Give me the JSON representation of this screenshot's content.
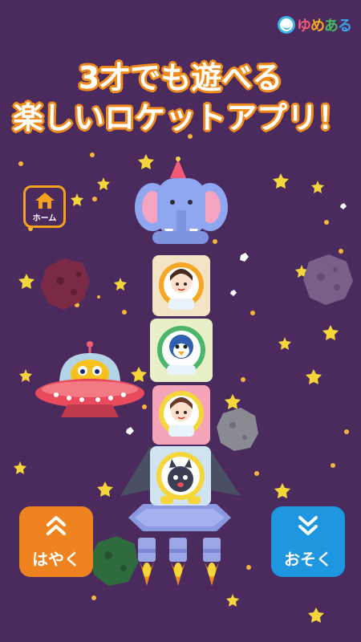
{
  "brand": {
    "logo_chars": [
      "ゆ",
      "め",
      "あ",
      "る"
    ]
  },
  "headline": {
    "line1": "3才でも遊べる",
    "line2": "楽しいロケットアプリ！"
  },
  "home_button": {
    "label": "ホーム",
    "icon": "home-icon"
  },
  "controls": {
    "fast": {
      "label": "はやく",
      "icon": "chevron-up-double-icon",
      "color": "#ef8320"
    },
    "slow": {
      "label": "おそく",
      "icon": "chevron-down-double-icon",
      "color": "#1e96e0"
    }
  },
  "rocket": {
    "top_passenger": "elephant",
    "crew": [
      "girl-astronaut",
      "penguin-astronaut",
      "girl-astronaut-pink",
      "cat-astronaut"
    ]
  },
  "colors": {
    "background": "#4b2b5e",
    "headline_outline": "#f08a1a",
    "star": "#f5d63a"
  }
}
